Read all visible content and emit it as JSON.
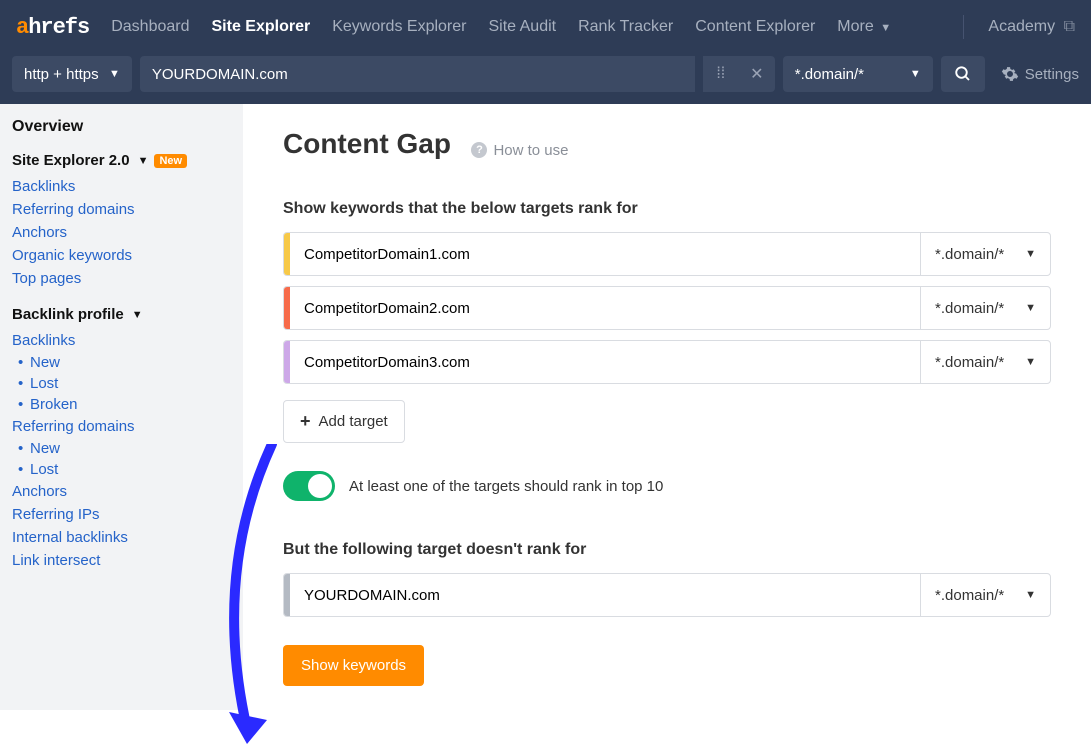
{
  "logo": {
    "prefix": "a",
    "rest": "hrefs"
  },
  "topnav": {
    "items": [
      "Dashboard",
      "Site Explorer",
      "Keywords Explorer",
      "Site Audit",
      "Rank Tracker",
      "Content Explorer",
      "More"
    ],
    "active_index": 1,
    "academy": "Academy"
  },
  "toolbar": {
    "protocol": "http + https",
    "domain_value": "YOURDOMAIN.com",
    "scope": "*.domain/*",
    "settings": "Settings"
  },
  "sidebar": {
    "overview": "Overview",
    "site_explorer": "Site Explorer 2.0",
    "new_badge": "New",
    "links1": [
      "Backlinks",
      "Referring domains",
      "Anchors",
      "Organic keywords",
      "Top pages"
    ],
    "backlink_profile": "Backlink profile",
    "bp_links": [
      "Backlinks"
    ],
    "bp_sub1": [
      "New",
      "Lost",
      "Broken"
    ],
    "bp_links2": [
      "Referring domains"
    ],
    "bp_sub2": [
      "New",
      "Lost"
    ],
    "bp_links3": [
      "Anchors",
      "Referring IPs",
      "Internal backlinks",
      "Link intersect"
    ]
  },
  "main": {
    "title": "Content Gap",
    "how_to_use": "How to use",
    "targets_label": "Show keywords that the below targets rank for",
    "targets": [
      {
        "domain": "CompetitorDomain1.com",
        "scope": "*.domain/*"
      },
      {
        "domain": "CompetitorDomain2.com",
        "scope": "*.domain/*"
      },
      {
        "domain": "CompetitorDomain3.com",
        "scope": "*.domain/*"
      }
    ],
    "add_target": "Add target",
    "toggle_label": "At least one of the targets should rank in top 10",
    "exclude_label": "But the following target doesn't rank for",
    "exclude": {
      "domain": "YOURDOMAIN.com",
      "scope": "*.domain/*"
    },
    "show_keywords": "Show keywords"
  }
}
